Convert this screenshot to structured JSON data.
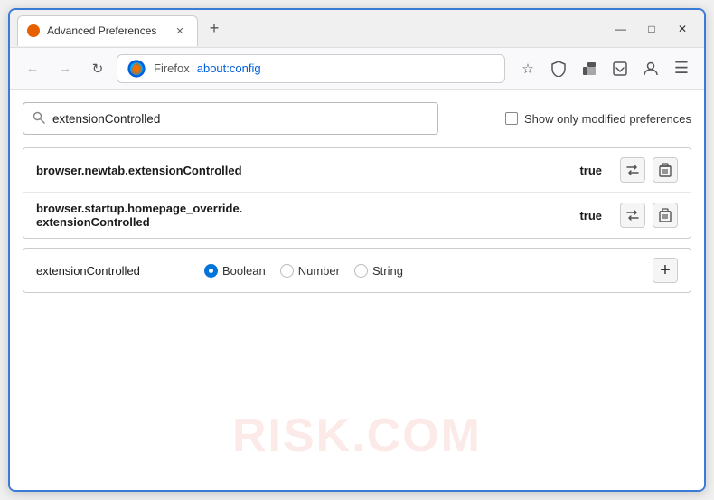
{
  "window": {
    "title": "Advanced Preferences",
    "new_tab_icon": "+",
    "minimize": "—",
    "maximize": "□",
    "close": "✕"
  },
  "navbar": {
    "back_disabled": true,
    "forward_disabled": true,
    "url_prefix": "Firefox",
    "url": "about:config",
    "star_icon": "☆",
    "shield_icon": "🛡",
    "extension_icon": "🧩",
    "pocket_icon": "📥",
    "profile_icon": "👤",
    "menu_icon": "☰"
  },
  "search": {
    "placeholder": "extensionControlled",
    "value": "extensionControlled",
    "show_modified_label": "Show only modified preferences"
  },
  "results": [
    {
      "name": "browser.newtab.extensionControlled",
      "value": "true"
    },
    {
      "name_line1": "browser.startup.homepage_override.",
      "name_line2": "extensionControlled",
      "value": "true"
    }
  ],
  "new_pref": {
    "name": "extensionControlled",
    "type_options": [
      {
        "label": "Boolean",
        "selected": true
      },
      {
        "label": "Number",
        "selected": false
      },
      {
        "label": "String",
        "selected": false
      }
    ],
    "add_label": "+"
  },
  "watermark": "RISK.COM"
}
